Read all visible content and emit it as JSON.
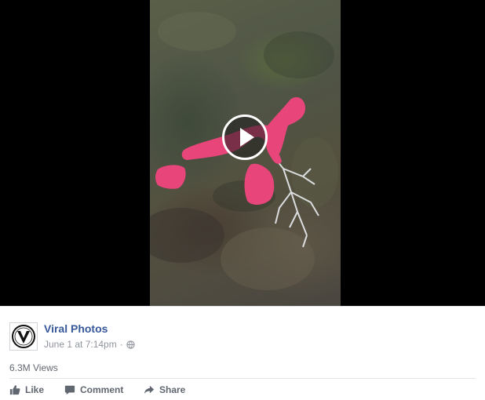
{
  "video": {
    "play_icon": "play-icon",
    "colors": {
      "letterbox": "#000000",
      "slime": "#e8457a",
      "roots": "#e9ecef"
    }
  },
  "post": {
    "page_name": "Viral Photos",
    "timestamp": "June 1 at 7:14pm",
    "separator": "·",
    "privacy_icon": "globe-icon",
    "avatar_icon": "viral-photos-logo",
    "views": "6.3M Views"
  },
  "actions": {
    "like_label": "Like",
    "comment_label": "Comment",
    "share_label": "Share"
  },
  "colors": {
    "link": "#365899",
    "meta": "#90949c",
    "action": "#616770"
  }
}
